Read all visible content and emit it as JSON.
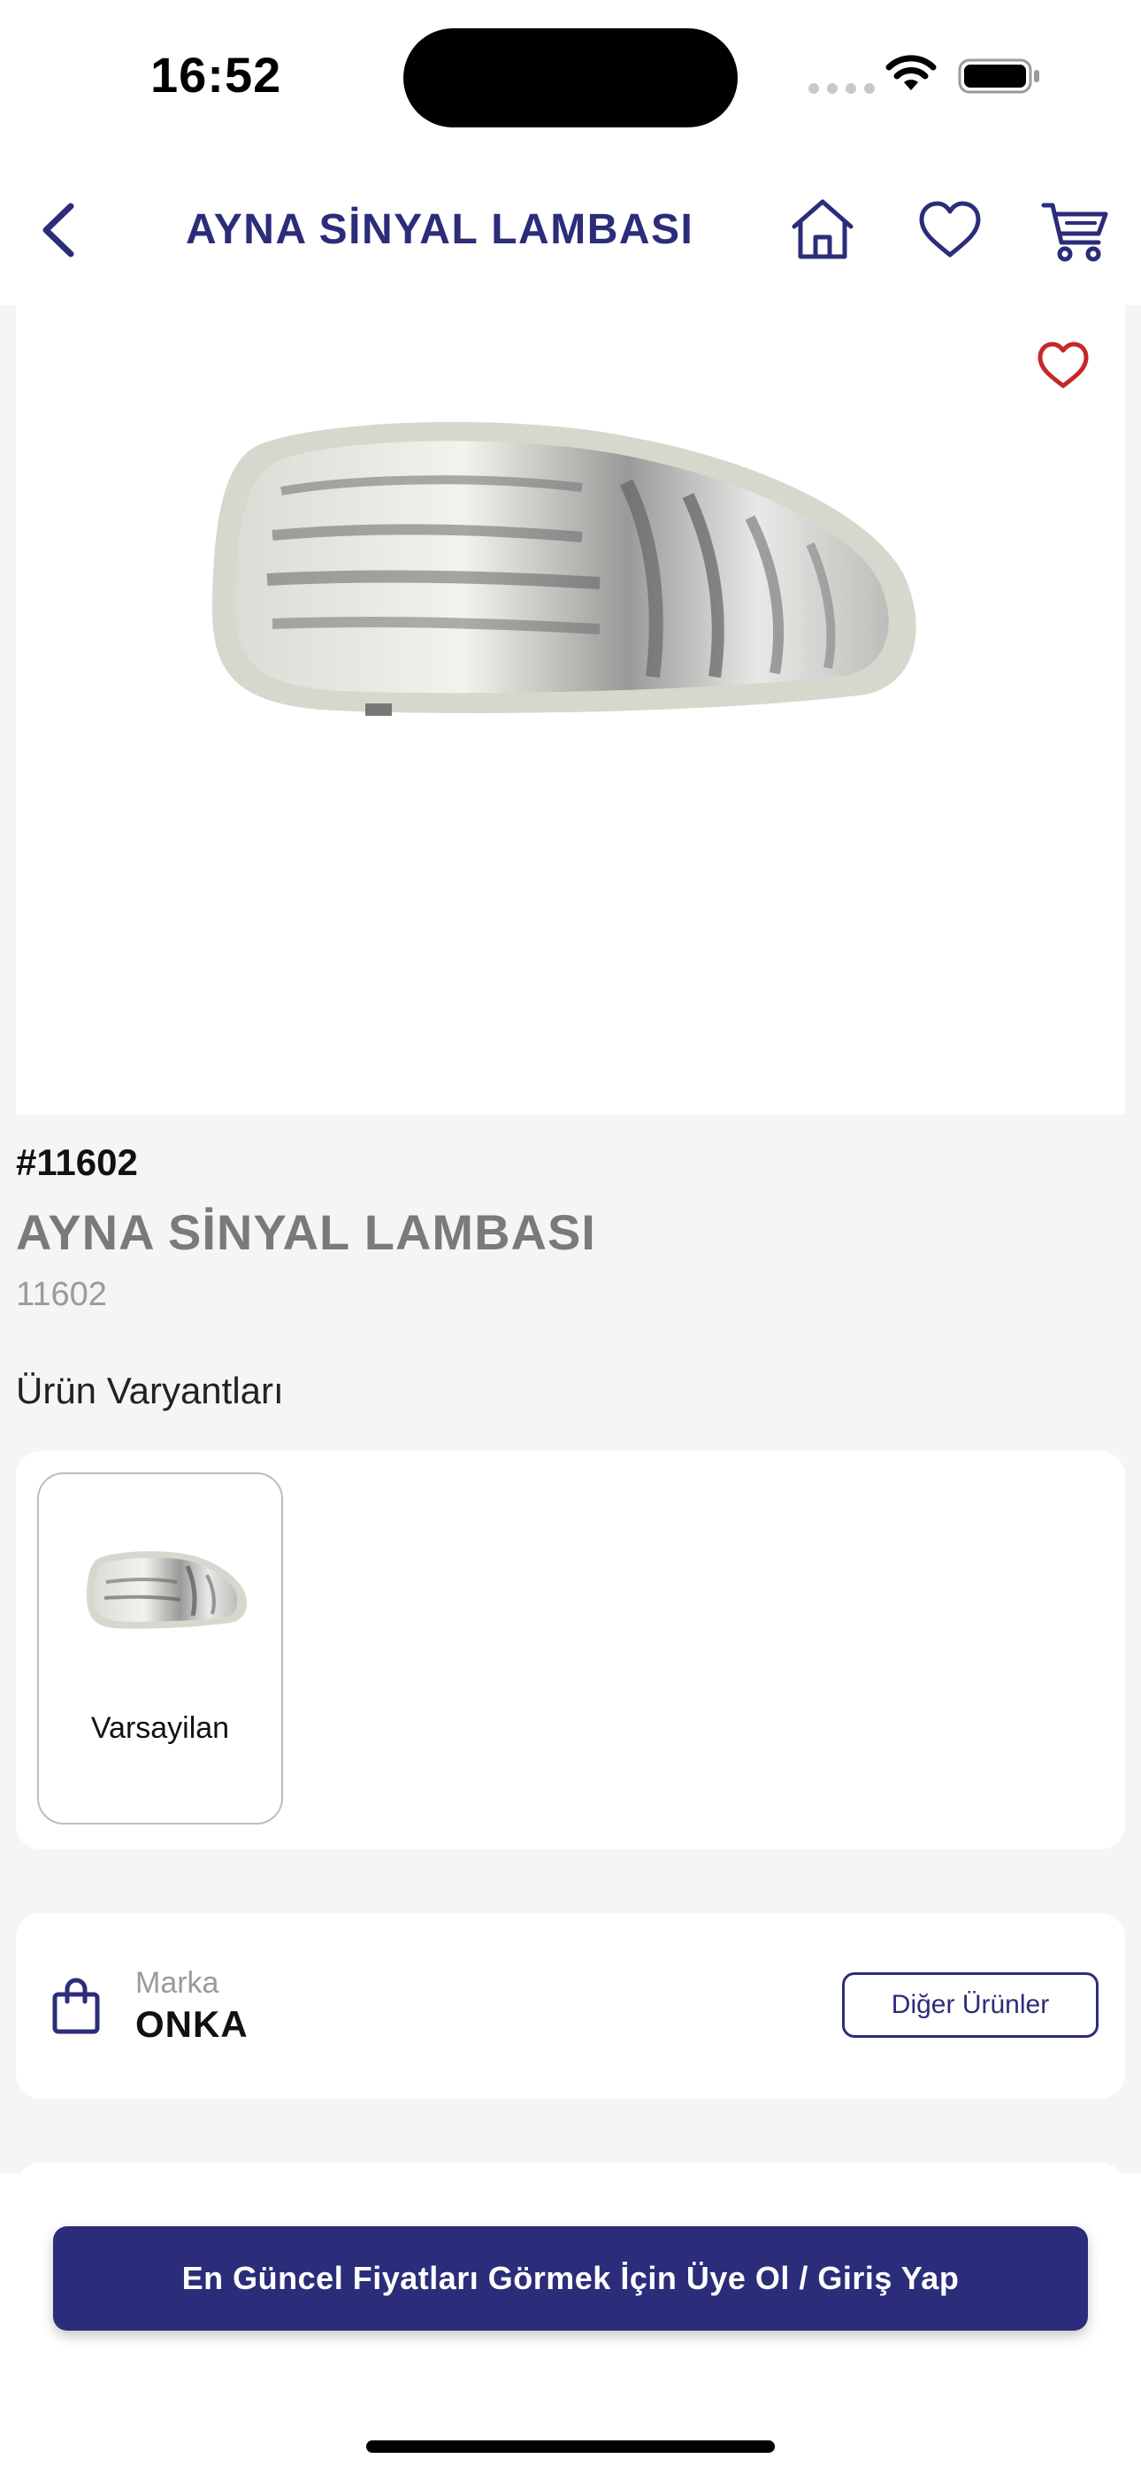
{
  "status_bar": {
    "time": "16:52"
  },
  "header": {
    "title": "AYNA SİNYAL LAMBASI",
    "icons": [
      "back-chevron-icon",
      "home-icon",
      "heart-icon",
      "cart-icon"
    ]
  },
  "product": {
    "sku": "#11602",
    "name": "AYNA SİNYAL LAMBASI",
    "code": "11602"
  },
  "variants": {
    "title": "Ürün Varyantları",
    "items": [
      {
        "label": "Varsayilan"
      }
    ]
  },
  "brand": {
    "label": "Marka",
    "value": "ONKA",
    "button": "Diğer Ürünler"
  },
  "cta": {
    "label": "En Güncel Fiyatları Görmek İçin Üye Ol / Giriş Yap"
  },
  "colors": {
    "brand_navy": "#2b2d7a",
    "favorite_red": "#c62828",
    "background": "#f5f5f5"
  }
}
